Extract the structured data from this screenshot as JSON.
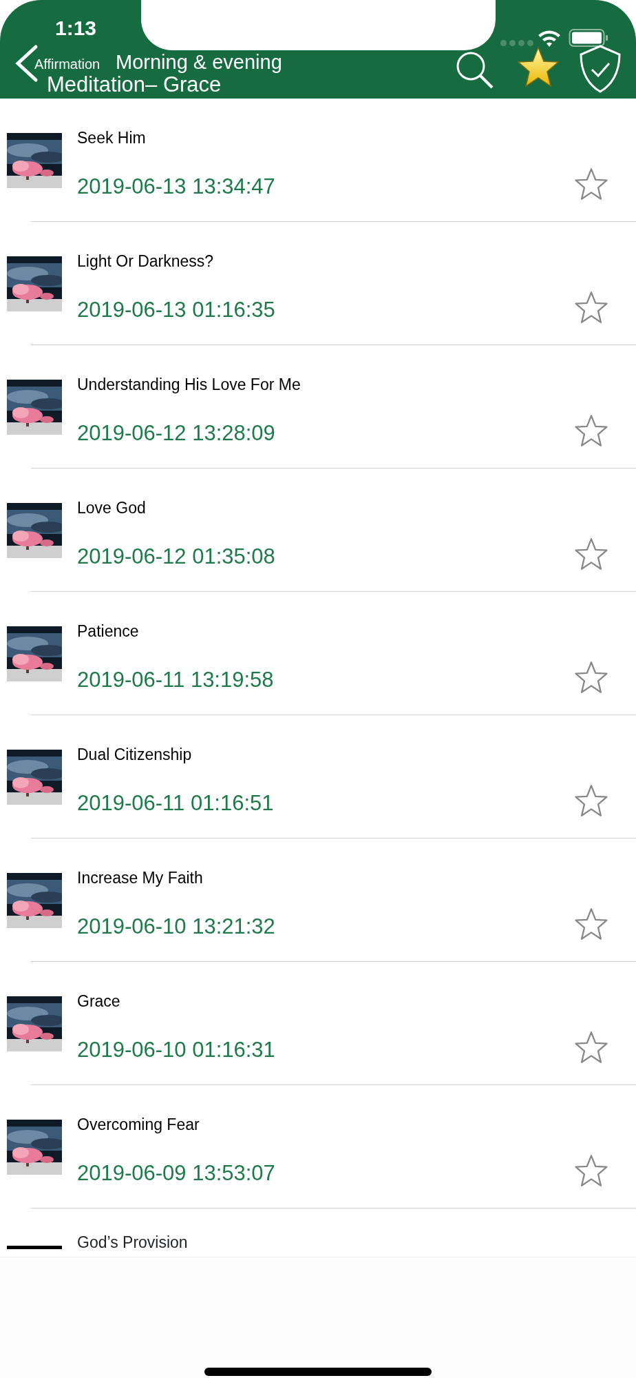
{
  "status_bar": {
    "time": "1:13"
  },
  "nav_bar": {
    "back_label": "Affirmation",
    "title_line_1": "Morning & evening",
    "title_line_2": "Meditation– Grace"
  },
  "entries": [
    {
      "title": "Seek Him",
      "date": "2019-06-13 13:34:47",
      "favorite": false
    },
    {
      "title": "Light Or Darkness?",
      "date": "2019-06-13 01:16:35",
      "favorite": false
    },
    {
      "title": "Understanding His Love For Me",
      "date": "2019-06-12 13:28:09",
      "favorite": false
    },
    {
      "title": "Love God",
      "date": "2019-06-12 01:35:08",
      "favorite": false
    },
    {
      "title": "Patience",
      "date": "2019-06-11 13:19:58",
      "favorite": false
    },
    {
      "title": "Dual Citizenship",
      "date": "2019-06-11 01:16:51",
      "favorite": false
    },
    {
      "title": "Increase My Faith",
      "date": "2019-06-10 13:21:32",
      "favorite": false
    },
    {
      "title": "Grace",
      "date": "2019-06-10 01:16:31",
      "favorite": false
    },
    {
      "title": "Overcoming Fear",
      "date": "2019-06-09 13:53:07",
      "favorite": false
    }
  ],
  "partial_entry": {
    "title": "God’s Provision"
  }
}
